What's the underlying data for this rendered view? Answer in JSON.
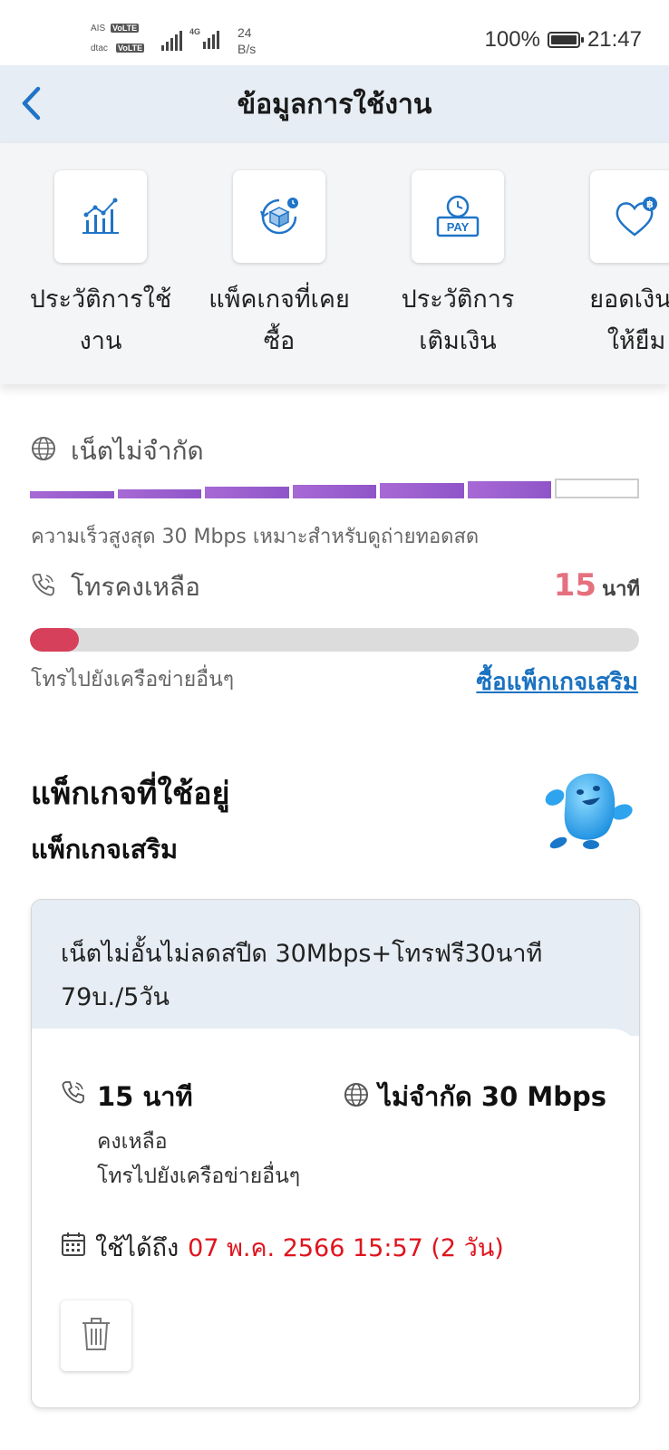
{
  "status_bar": {
    "carrier1": "AIS",
    "carrier2": "dtac",
    "volte": "VoLTE",
    "net_type": "4G",
    "speed_value": "24",
    "speed_unit": "B/s",
    "battery": "100%",
    "time": "21:47"
  },
  "header": {
    "title": "ข้อมูลการใช้งาน",
    "back_icon": "chevron-left-icon"
  },
  "quick_menu": [
    {
      "label_line1": "ประวัติการใช้",
      "label_line2": "งาน",
      "icon": "chart-icon"
    },
    {
      "label_line1": "แพ็คเกจที่เคย",
      "label_line2": "ซื้อ",
      "icon": "box-history-icon"
    },
    {
      "label_line1": "ประวัติการ",
      "label_line2": "เติมเงิน",
      "icon": "pay-clock-icon"
    },
    {
      "label_line1": "ยอดเงินใ",
      "label_line2": "ให้ยืม",
      "icon": "heart-baht-icon"
    }
  ],
  "internet": {
    "label": "เน็ตไม่จำกัด",
    "note": "ความเร็วสูงสุด 30 Mbps เหมาะสำหรับดูถ่ายทอดสด",
    "segments_filled": 6,
    "segments_total": 7
  },
  "call": {
    "label": "โทรคงเหลือ",
    "value": "15",
    "unit": "นาที",
    "remaining_fraction": 0.08,
    "note": "โทรไปยังเครือข่ายอื่นๆ",
    "buy_link": "ซื้อแพ็กเกจเสริม"
  },
  "active_packages": {
    "title": "แพ็กเกจที่ใช้อยู่",
    "subtitle": "แพ็กเกจเสริม",
    "package": {
      "name_line1": "เน็ตไม่อั้นไม่ลดสปีด 30Mbps+โทรฟรี30นาที",
      "name_line2": "79บ./5วัน",
      "call_value": "15 นาที",
      "call_sub1": "คงเหลือ",
      "call_sub2": "โทรไปยังเครือข่ายอื่นๆ",
      "data_value": "ไม่จำกัด 30 Mbps",
      "expire_label": "ใช้ได้ถึง",
      "expire_date": "07 พ.ค. 2566 15:57 (2 วัน)"
    }
  },
  "colors": {
    "accent_blue": "#1f74c7",
    "data_bar": "#9d60cf",
    "call_bar": "#d6405a",
    "expire_red": "#e0141e",
    "header_bg": "#e6edf4"
  }
}
